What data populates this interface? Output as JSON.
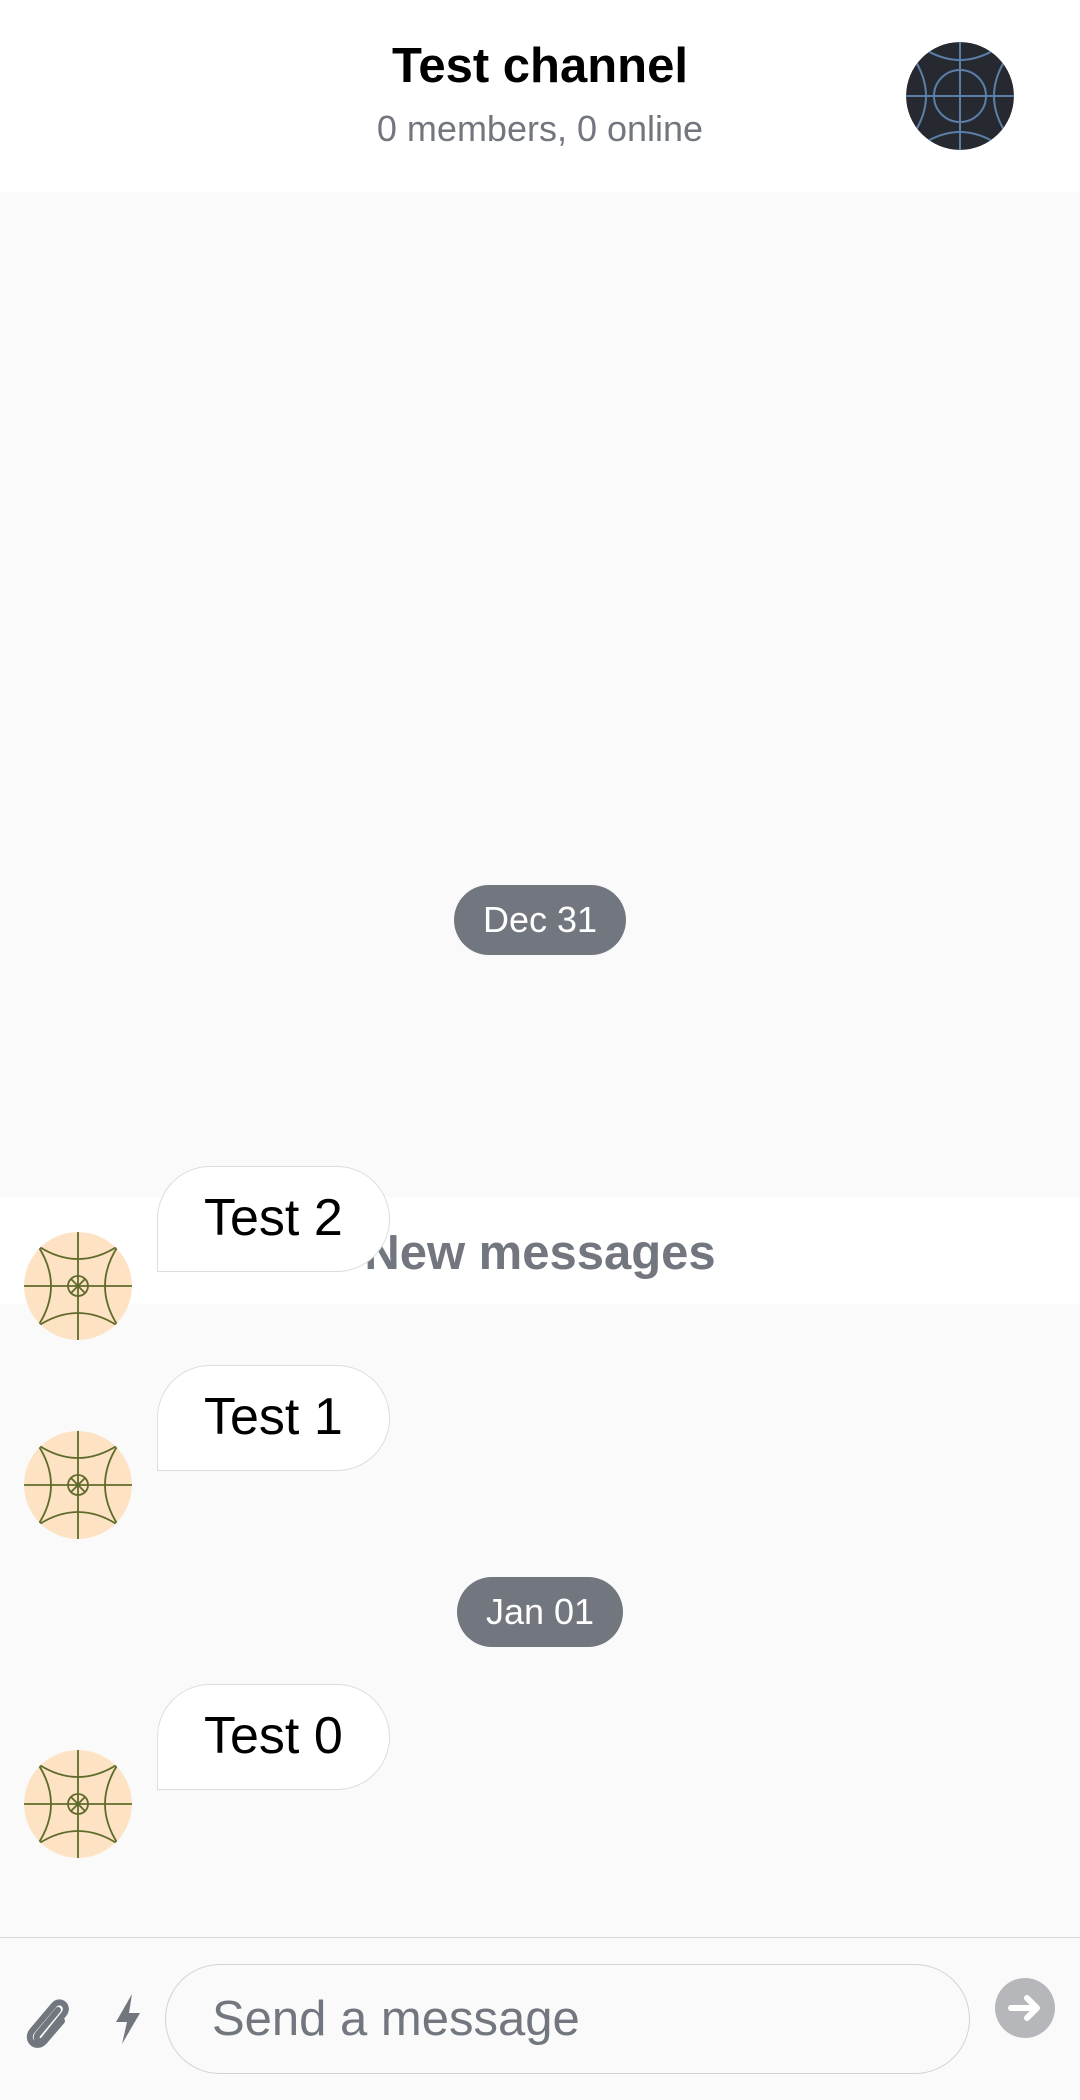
{
  "header": {
    "title": "Test channel",
    "subtitle": "0 members, 0 online",
    "avatar_icon": "channel-avatar-pattern"
  },
  "chat": {
    "date_separators": [
      "Dec 31",
      "Jan 01"
    ],
    "new_messages_label": "New messages",
    "messages": [
      {
        "text": "Test 2",
        "avatar_icon": "user-avatar-pattern"
      },
      {
        "text": "Test 1",
        "avatar_icon": "user-avatar-pattern"
      },
      {
        "text": "Test 0",
        "avatar_icon": "user-avatar-pattern"
      }
    ]
  },
  "composer": {
    "placeholder": "Send a message",
    "attach_icon": "paperclip-icon",
    "commands_icon": "lightning-icon",
    "send_icon": "arrow-right-icon"
  },
  "colors": {
    "header_bg": "#ffffff",
    "chat_bg": "#fafafa",
    "muted_text": "#72767e",
    "date_pill": "#72767e",
    "avatar_peach": "#fde2c4",
    "avatar_dark": "#262a30"
  }
}
